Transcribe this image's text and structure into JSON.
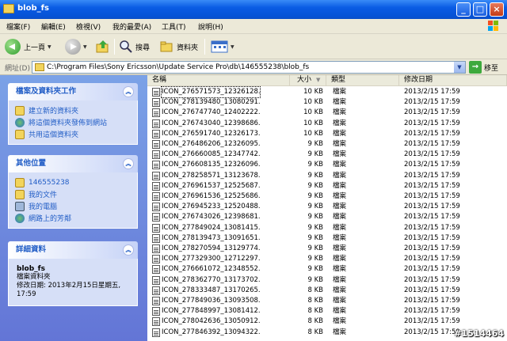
{
  "window": {
    "title": "blob_fs"
  },
  "menu": [
    "檔案(F)",
    "編輯(E)",
    "檢視(V)",
    "我的最愛(A)",
    "工具(T)",
    "說明(H)"
  ],
  "toolbar": {
    "back": "上一頁",
    "search": "搜尋",
    "folders": "資料夾"
  },
  "address": {
    "label": "網址(D)",
    "value": "C:\\Program Files\\Sony Ericsson\\Update Service Pro\\db\\146555238\\blob_fs",
    "go": "移至"
  },
  "tasks": {
    "title": "檔案及資料夾工作",
    "items": [
      "建立新的資料夾",
      "將這個資料夾發佈到網站",
      "共用這個資料夾"
    ]
  },
  "places": {
    "title": "其他位置",
    "items": [
      "146555238",
      "我的文件",
      "我的電腦",
      "網路上的芳鄰"
    ]
  },
  "details": {
    "title": "詳細資料",
    "name": "blob_fs",
    "type": "檔案資料夾",
    "modified": "修改日期: 2013年2月15日星期五, 17:59"
  },
  "columns": {
    "name": "名稱",
    "size": "大小",
    "type": "類型",
    "date": "修改日期"
  },
  "files": [
    {
      "name": "ICON_276571573_12326128...",
      "size": "10 KB",
      "type": "檔案",
      "date": "2013/2/15 17:59"
    },
    {
      "name": "ICON_278139480_13080291...",
      "size": "10 KB",
      "type": "檔案",
      "date": "2013/2/15 17:59"
    },
    {
      "name": "ICON_276747740_12402222...",
      "size": "10 KB",
      "type": "檔案",
      "date": "2013/2/15 17:59"
    },
    {
      "name": "ICON_276743040_12398686...",
      "size": "10 KB",
      "type": "檔案",
      "date": "2013/2/15 17:59"
    },
    {
      "name": "ICON_276591740_12326173...",
      "size": "10 KB",
      "type": "檔案",
      "date": "2013/2/15 17:59"
    },
    {
      "name": "ICON_276486206_12326095...",
      "size": "9 KB",
      "type": "檔案",
      "date": "2013/2/15 17:59"
    },
    {
      "name": "ICON_276660085_12347742...",
      "size": "9 KB",
      "type": "檔案",
      "date": "2013/2/15 17:59"
    },
    {
      "name": "ICON_276608135_12326096...",
      "size": "9 KB",
      "type": "檔案",
      "date": "2013/2/15 17:59"
    },
    {
      "name": "ICON_278258571_13123678...",
      "size": "9 KB",
      "type": "檔案",
      "date": "2013/2/15 17:59"
    },
    {
      "name": "ICON_276961537_12525687...",
      "size": "9 KB",
      "type": "檔案",
      "date": "2013/2/15 17:59"
    },
    {
      "name": "ICON_276961536_12525686...",
      "size": "9 KB",
      "type": "檔案",
      "date": "2013/2/15 17:59"
    },
    {
      "name": "ICON_276945233_12520488...",
      "size": "9 KB",
      "type": "檔案",
      "date": "2013/2/15 17:59"
    },
    {
      "name": "ICON_276743026_12398681...",
      "size": "9 KB",
      "type": "檔案",
      "date": "2013/2/15 17:59"
    },
    {
      "name": "ICON_277849024_13081415...",
      "size": "9 KB",
      "type": "檔案",
      "date": "2013/2/15 17:59"
    },
    {
      "name": "ICON_278139473_13091651...",
      "size": "9 KB",
      "type": "檔案",
      "date": "2013/2/15 17:59"
    },
    {
      "name": "ICON_278270594_13129774...",
      "size": "9 KB",
      "type": "檔案",
      "date": "2013/2/15 17:59"
    },
    {
      "name": "ICON_277329300_12712297...",
      "size": "9 KB",
      "type": "檔案",
      "date": "2013/2/15 17:59"
    },
    {
      "name": "ICON_276661072_12348552...",
      "size": "9 KB",
      "type": "檔案",
      "date": "2013/2/15 17:59"
    },
    {
      "name": "ICON_278362770_13173702...",
      "size": "9 KB",
      "type": "檔案",
      "date": "2013/2/15 17:59"
    },
    {
      "name": "ICON_278333487_13170265...",
      "size": "8 KB",
      "type": "檔案",
      "date": "2013/2/15 17:59"
    },
    {
      "name": "ICON_277849036_13093508...",
      "size": "8 KB",
      "type": "檔案",
      "date": "2013/2/15 17:59"
    },
    {
      "name": "ICON_277848997_13081412...",
      "size": "8 KB",
      "type": "檔案",
      "date": "2013/2/15 17:59"
    },
    {
      "name": "ICON_278042636_13050912...",
      "size": "8 KB",
      "type": "檔案",
      "date": "2013/2/15 17:59"
    },
    {
      "name": "ICON_277846392_13094322...",
      "size": "8 KB",
      "type": "檔案",
      "date": "2013/2/15 17:59"
    }
  ],
  "watermark": "#1514464"
}
